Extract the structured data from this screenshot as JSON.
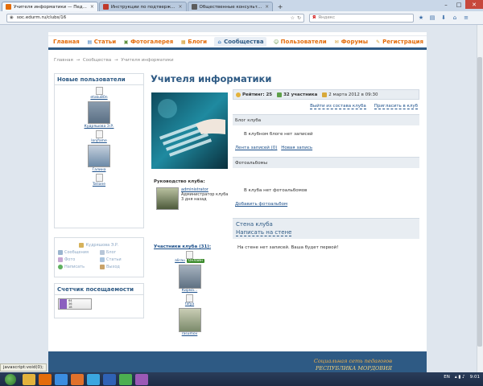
{
  "browser": {
    "tabs": [
      {
        "title": "Учителя информатики — Пед...",
        "active": true,
        "favicon_color": "#e36c0a"
      },
      {
        "title": "Инструкции по подтверж...",
        "active": false,
        "favicon_color": "#c0392b"
      },
      {
        "title": "Общественные консульт...",
        "active": false,
        "favicon_color": "#5c5c5c"
      }
    ],
    "new_tab": "+",
    "url": "soc.edurm.ru/clubs/16",
    "search_engine_glyph": "Я",
    "search_placeholder": "Яндекс",
    "window_controls": {
      "minimize": "–",
      "maximize": "□",
      "close": "✕"
    }
  },
  "site": {
    "menu": [
      {
        "label": "Главная",
        "icon": "none"
      },
      {
        "label": "Статьи",
        "icon": "articles-icon"
      },
      {
        "label": "Фотогалерея",
        "icon": "photo-icon"
      },
      {
        "label": "Блоги",
        "icon": "blog-icon"
      },
      {
        "label": "Сообщества",
        "icon": "community-icon",
        "active": true
      },
      {
        "label": "Пользователи",
        "icon": "users-icon"
      },
      {
        "label": "Форумы",
        "icon": "forum-icon"
      },
      {
        "label": "Регистрация",
        "icon": "register-icon"
      }
    ],
    "breadcrumb": [
      "Главная",
      "→",
      "Сообщества",
      "→",
      "Учителя информатики"
    ],
    "sidebar": {
      "new_users_title": "Новые пользователи",
      "new_users": [
        {
          "name": "etaku80n",
          "photo": false
        },
        {
          "name": "Кудряшова Э.Р.",
          "photo": true,
          "photo_color": "#5a6f84"
        },
        {
          "name": "lonjfame",
          "photo": false
        },
        {
          "name": "Галина",
          "photo": true,
          "photo_color": "#6c8aa8"
        },
        {
          "name": "Tatiane",
          "photo": false
        }
      ],
      "links": [
        {
          "label": "Кудряшова Э.Р.",
          "icon_color": "#d6b25b",
          "center": true
        },
        {
          "label": "Сообщения",
          "icon_color": "#9bb5cf"
        },
        {
          "label": "Блог",
          "icon_color": "#b8c7d8"
        },
        {
          "label": "Фото",
          "icon_color": "#c7a7d3"
        },
        {
          "label": "Статьи",
          "icon_color": "#a9c4de"
        },
        {
          "label": "Написать",
          "icon_color": "#5fb05f"
        },
        {
          "label": "Выход",
          "icon_color": "#c9a36a"
        }
      ],
      "counter_title": "Счетчик посещаемости",
      "counter_values": [
        "64",
        "36",
        "18"
      ]
    },
    "club": {
      "title": "Учителя информатики",
      "hero_icon": "keyboard-hand-image",
      "leadership_label": "Руководство клуба:",
      "leader": {
        "name": "administrator",
        "role": "Администратор клуба",
        "when": "3 дня назад"
      },
      "members_label": "Участники клуба (31):",
      "members": [
        {
          "name": "alirau",
          "photo": false,
          "online": "Онлайн"
        },
        {
          "name": "Кирма...",
          "photo": true,
          "photo_color": "#5f7183"
        },
        {
          "name": "fafya",
          "photo": false
        },
        {
          "name": "rasumov",
          "photo": true,
          "photo_color": "#7b8a6a"
        }
      ],
      "info": {
        "rating": "Рейтинг: 25",
        "participants": "32 участника",
        "date": "2 марта 2012 в 09:30"
      },
      "actions": {
        "leave": "Выйти из состава клуба",
        "invite": "Пригласить в клуб"
      },
      "blog": {
        "title": "Блог клуба",
        "empty": "В клубном блоге нет записей",
        "feed_link": "Лента записей (0)",
        "new_link": "Новая запись"
      },
      "albums": {
        "title": "Фотоальбомы",
        "empty": "В клуба нет фотоальбомов",
        "add_link": "Добавить фотоальбом"
      },
      "wall": {
        "title": "Стена клуба",
        "write": "Написать на стене",
        "empty": "На стене нет записей. Ваша будет первой!"
      }
    },
    "footer": {
      "line1": "Социальная сеть педагогов",
      "line2": "РЕСПУБЛИКА МОРДОВИЯ"
    }
  },
  "status_tip": "javascript:void(0);",
  "taskbar": {
    "apps": [
      {
        "icon": "folder-icon",
        "color": "#e3b23c"
      },
      {
        "icon": "media-icon",
        "color": "#e36c0a"
      },
      {
        "icon": "browser-icon",
        "color": "#3b8de0"
      },
      {
        "icon": "firefox-icon",
        "color": "#e0712b"
      },
      {
        "icon": "skype-icon",
        "color": "#3aa6e0"
      },
      {
        "icon": "word-icon",
        "color": "#2f62b5"
      },
      {
        "icon": "chrome-icon",
        "color": "#4caf50"
      },
      {
        "icon": "app-icon",
        "color": "#9b59b6"
      }
    ],
    "lang": "EN",
    "time": "9:01"
  }
}
